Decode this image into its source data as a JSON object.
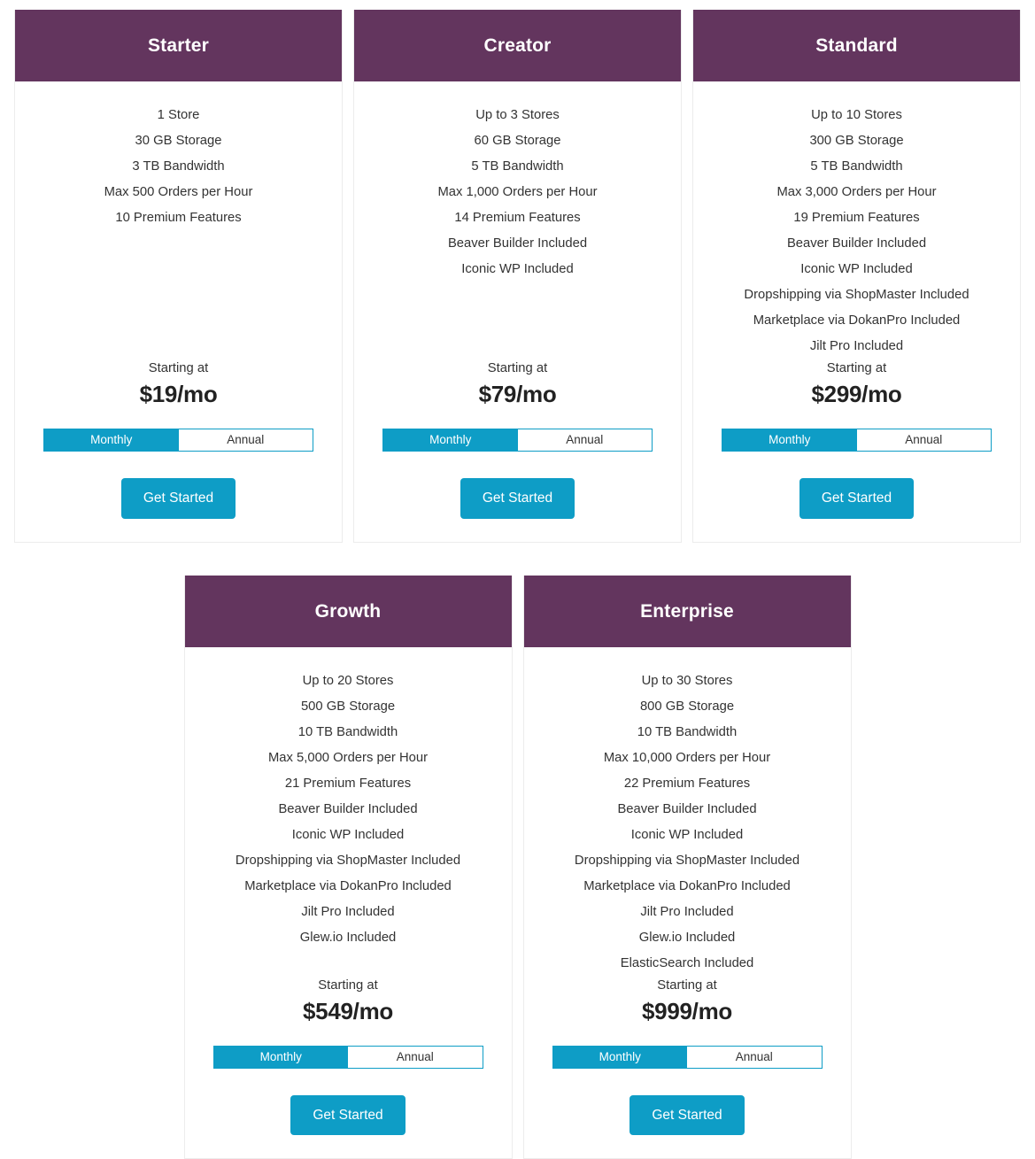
{
  "labels": {
    "starting_at": "Starting at",
    "monthly": "Monthly",
    "annual": "Annual",
    "get_started": "Get Started"
  },
  "colors": {
    "header_purple": "#63355E",
    "accent_teal": "#0E9DC6",
    "card_border": "#ECECEC",
    "text": "#333333",
    "price_text": "#222222"
  },
  "rows": [
    {
      "cards": [
        {
          "name": "Starter",
          "features": [
            "1 Store",
            "30 GB Storage",
            "3 TB Bandwidth",
            "Max 500 Orders per Hour",
            "10 Premium Features"
          ],
          "starting_at": "Starting at",
          "price": "$19/mo",
          "term_selected": "Monthly",
          "terms": [
            "Monthly",
            "Annual"
          ],
          "cta": "Get Started"
        },
        {
          "name": "Creator",
          "features": [
            "Up to 3 Stores",
            "60 GB Storage",
            "5 TB Bandwidth",
            "Max 1,000 Orders per Hour",
            "14 Premium Features",
            "Beaver Builder Included",
            "Iconic WP Included"
          ],
          "starting_at": "Starting at",
          "price": "$79/mo",
          "term_selected": "Monthly",
          "terms": [
            "Monthly",
            "Annual"
          ],
          "cta": "Get Started"
        },
        {
          "name": "Standard",
          "features": [
            "Up to 10 Stores",
            "300 GB Storage",
            "5 TB Bandwidth",
            "Max 3,000 Orders per Hour",
            "19 Premium Features",
            "Beaver Builder Included",
            "Iconic WP Included",
            "Dropshipping via ShopMaster Included",
            "Marketplace via DokanPro Included",
            "Jilt Pro Included"
          ],
          "starting_at": "Starting at",
          "price": "$299/mo",
          "term_selected": "Monthly",
          "terms": [
            "Monthly",
            "Annual"
          ],
          "cta": "Get Started"
        }
      ]
    },
    {
      "cards": [
        {
          "name": "Growth",
          "features": [
            "Up to 20 Stores",
            "500 GB Storage",
            "10 TB Bandwidth",
            "Max 5,000 Orders per Hour",
            "21 Premium Features",
            "Beaver Builder Included",
            "Iconic WP Included",
            "Dropshipping via ShopMaster Included",
            "Marketplace via DokanPro Included",
            "Jilt Pro Included",
            "Glew.io Included"
          ],
          "starting_at": "Starting at",
          "price": "$549/mo",
          "term_selected": "Monthly",
          "terms": [
            "Monthly",
            "Annual"
          ],
          "cta": "Get Started"
        },
        {
          "name": "Enterprise",
          "features": [
            "Up to 30 Stores",
            "800 GB Storage",
            "10 TB Bandwidth",
            "Max 10,000 Orders per Hour",
            "22 Premium Features",
            "Beaver Builder Included",
            "Iconic WP Included",
            "Dropshipping via ShopMaster Included",
            "Marketplace via DokanPro Included",
            "Jilt Pro Included",
            "Glew.io Included",
            "ElasticSearch Included"
          ],
          "starting_at": "Starting at",
          "price": "$999/mo",
          "term_selected": "Monthly",
          "terms": [
            "Monthly",
            "Annual"
          ],
          "cta": "Get Started"
        }
      ]
    }
  ]
}
